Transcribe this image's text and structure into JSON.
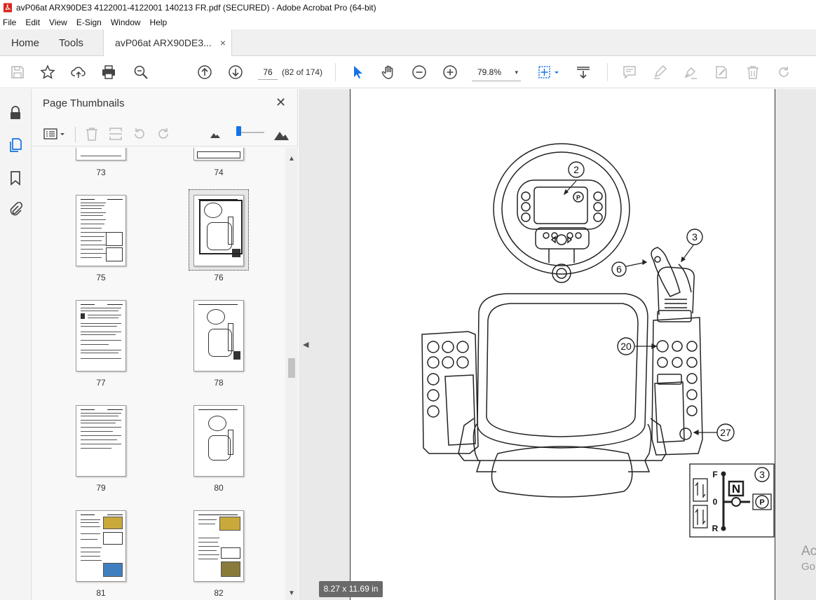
{
  "window": {
    "title": "avP06at ARX90DE3 4122001-4122001 140213 FR.pdf (SECURED) - Adobe Acrobat Pro (64-bit)"
  },
  "menu": [
    "File",
    "Edit",
    "View",
    "E-Sign",
    "Window",
    "Help"
  ],
  "tabs": {
    "home": "Home",
    "tools": "Tools",
    "document": "avP06at ARX90DE3...",
    "close": "×"
  },
  "toolbar": {
    "page_number": "76",
    "page_count": "(82 of 174)",
    "zoom": "79.8%",
    "zoom_caret": "▾"
  },
  "panel": {
    "title": "Page Thumbnails",
    "close": "✕",
    "thumbnails": [
      {
        "label": "73"
      },
      {
        "label": "74"
      },
      {
        "label": "75"
      },
      {
        "label": "76"
      },
      {
        "label": "77"
      },
      {
        "label": "78"
      },
      {
        "label": "79"
      },
      {
        "label": "80"
      },
      {
        "label": "81"
      },
      {
        "label": "82"
      }
    ]
  },
  "document": {
    "page_size": "8.27 x 11.69 in",
    "callouts": [
      "2",
      "3",
      "6",
      "20",
      "27"
    ],
    "inset": {
      "callout": "3",
      "forward": "F",
      "neutral_pos": "0",
      "reverse": "R",
      "neutral": "N",
      "park": "P"
    }
  },
  "watermark": {
    "line1": "Ac",
    "line2": "Go"
  },
  "icons": {
    "save": "save-icon",
    "bookmark": "star-icon",
    "upload": "upload-icon",
    "print": "print-icon",
    "find": "zoom-search-icon",
    "prev": "arrow-up-circle-icon",
    "next": "arrow-down-circle-icon",
    "select": "cursor-arrow-icon",
    "hand": "hand-icon",
    "zoom_out": "zoom-out-icon",
    "zoom_in": "zoom-in-icon"
  },
  "colors": {
    "accent": "#1473e6",
    "panel_bg": "#f8f8f8",
    "doc_bg": "#e9e9e9"
  }
}
